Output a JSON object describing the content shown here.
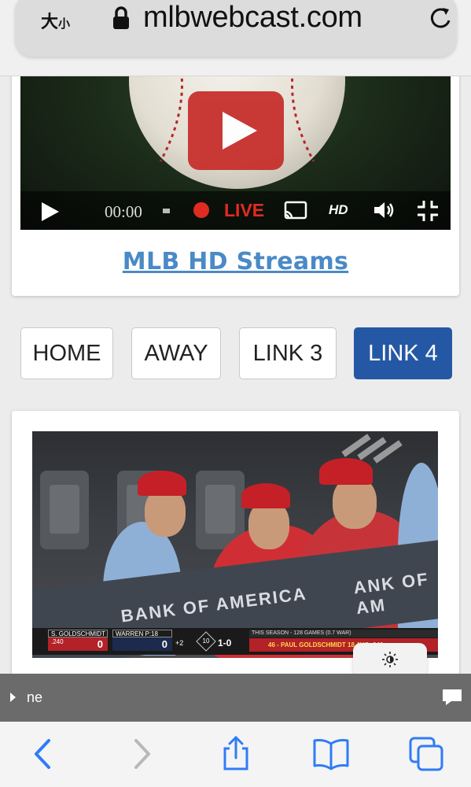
{
  "browser": {
    "text_size_label": "大",
    "text_size_small": "小",
    "url": "mlbwebcast.com"
  },
  "player": {
    "time": "00:00",
    "live_label": "LIVE",
    "hd_label": "HD"
  },
  "streams_link": "MLB HD Streams",
  "buttons": [
    {
      "label": "HOME",
      "active": false
    },
    {
      "label": "AWAY",
      "active": false
    },
    {
      "label": "LINK 3",
      "active": false
    },
    {
      "label": "LINK 4",
      "active": true
    }
  ],
  "thumbnail": {
    "wall_text": "BANK OF AMERICA",
    "wall_text2": "ANK OF AM",
    "scorebug": {
      "team1_label": "S. GOLDSCHMIDT .240",
      "team1_score": "0",
      "team2_label": "WARREN P:18",
      "team2_score": "0",
      "count": "1-0",
      "outs": "+2",
      "pitch": "10",
      "ticker_top": "THIS SEASON - 128 GAMES (0.7 WAR)",
      "ticker_bottom": "46 - PAUL GOLDSCHMIDT 18  AVG .240"
    }
  },
  "caption_text": "ne",
  "colors": {
    "accent_blue": "#2458a4",
    "link_blue": "#4a8ac6",
    "live_red": "#e02b22",
    "toolbar_icon": "#2f7cf6"
  }
}
